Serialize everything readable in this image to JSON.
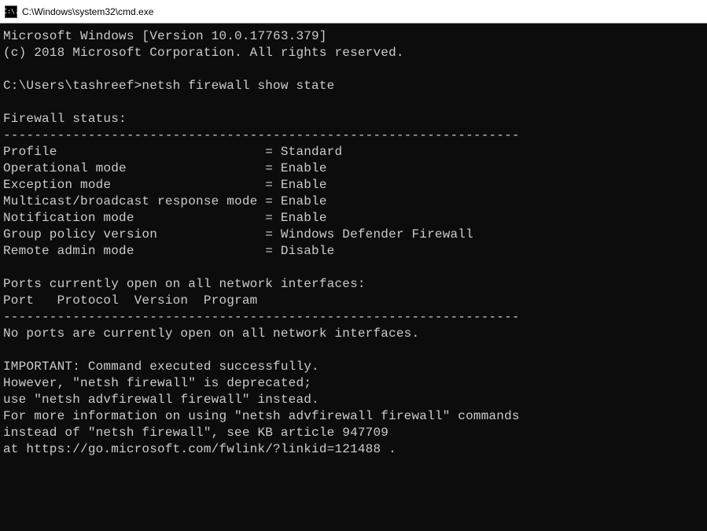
{
  "titlebar": {
    "icon_text": "C:\\.",
    "path": "C:\\Windows\\system32\\cmd.exe"
  },
  "console": {
    "line_version": "Microsoft Windows [Version 10.0.17763.379]",
    "line_copyright": "(c) 2018 Microsoft Corporation. All rights reserved.",
    "blank": "",
    "prompt_line": "C:\\Users\\tashreef>netsh firewall show state",
    "status_header": "Firewall status:",
    "hr": "-------------------------------------------------------------------",
    "row_profile": "Profile                           = Standard",
    "row_opmode": "Operational mode                  = Enable",
    "row_exception": "Exception mode                    = Enable",
    "row_multicast": "Multicast/broadcast response mode = Enable",
    "row_notification": "Notification mode                 = Enable",
    "row_gpolicy": "Group policy version              = Windows Defender Firewall",
    "row_remoteadmin": "Remote admin mode                 = Disable",
    "ports_header": "Ports currently open on all network interfaces:",
    "ports_columns": "Port   Protocol  Version  Program",
    "no_ports": "No ports are currently open on all network interfaces.",
    "important_1": "IMPORTANT: Command executed successfully.",
    "important_2": "However, \"netsh firewall\" is deprecated;",
    "important_3": "use \"netsh advfirewall firewall\" instead.",
    "important_4": "For more information on using \"netsh advfirewall firewall\" commands",
    "important_5": "instead of \"netsh firewall\", see KB article 947709",
    "important_6": "at https://go.microsoft.com/fwlink/?linkid=121488 ."
  }
}
